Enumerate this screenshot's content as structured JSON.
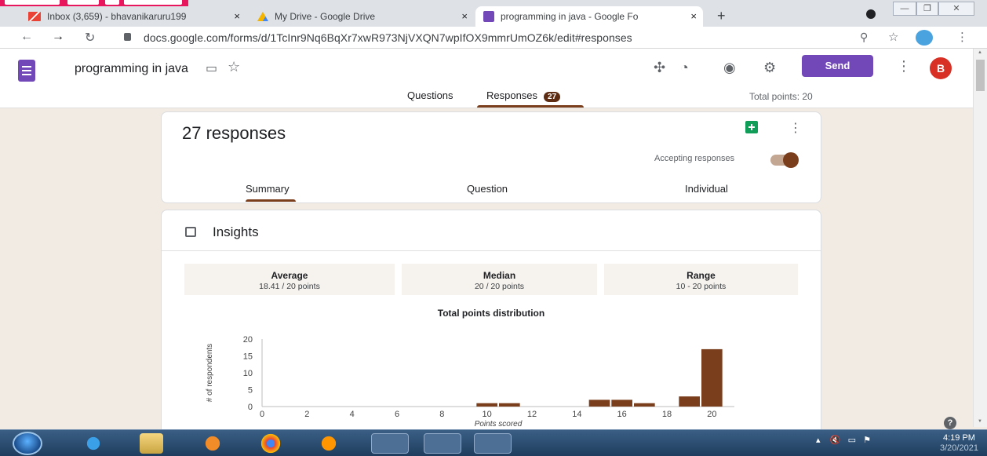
{
  "browser": {
    "tabs": [
      {
        "title": "Inbox (3,659) - bhavanikaruru199",
        "close": "×"
      },
      {
        "title": "My Drive - Google Drive",
        "close": "×"
      },
      {
        "title": "programming in java - Google Fo",
        "close": "×"
      }
    ],
    "new_tab": "+",
    "window_controls": [
      "—",
      "❐",
      "✕"
    ],
    "url": "docs.google.com/forms/d/1TcInr9Nq6BqXr7xwR973NjVXQN7wpIfOX9mmrUmOZ6k/edit#responses"
  },
  "form": {
    "title": "programming in java",
    "send_label": "Send",
    "avatar_letter": "B",
    "tabs": {
      "questions": "Questions",
      "responses": "Responses",
      "responses_count": "27"
    },
    "total_points": "Total points: 20"
  },
  "responses_card": {
    "count_label": "27 responses",
    "accepting_label": "Accepting responses",
    "accepting": true,
    "subtabs": [
      "Summary",
      "Question",
      "Individual"
    ]
  },
  "insights": {
    "title": "Insights",
    "stats": [
      {
        "label": "Average",
        "value": "18.41 / 20 points"
      },
      {
        "label": "Median",
        "value": "20 / 20 points"
      },
      {
        "label": "Range",
        "value": "10 - 20 points"
      }
    ]
  },
  "chart_data": {
    "type": "bar",
    "title": "Total points distribution",
    "xlabel": "Points scored",
    "ylabel": "# of respondents",
    "x": [
      10,
      11,
      15,
      16,
      17,
      19,
      20
    ],
    "values": [
      1,
      1,
      2,
      2,
      1,
      3,
      17
    ],
    "xlim": [
      0,
      21
    ],
    "ylim": [
      0,
      20
    ],
    "xticks": [
      0,
      2,
      4,
      6,
      8,
      10,
      12,
      14,
      16,
      18,
      20
    ],
    "yticks": [
      0,
      5,
      10,
      15,
      20
    ],
    "color": "#7b3e1c"
  },
  "taskbar": {
    "time": "4:19 PM",
    "date": "3/20/2021"
  },
  "help": "?"
}
